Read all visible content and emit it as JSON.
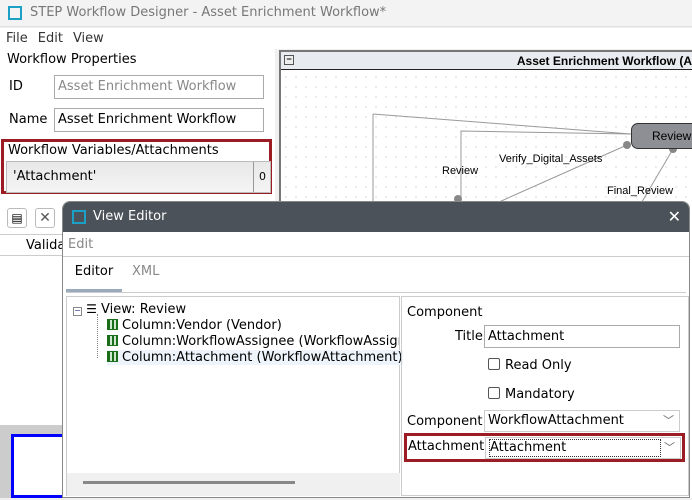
{
  "window": {
    "title": "STEP Workflow Designer - Asset Enrichment Workflow*"
  },
  "menu": [
    "File",
    "Edit",
    "View"
  ],
  "properties": {
    "heading": "Workflow Properties",
    "id_label": "ID",
    "id_value": "Asset Enrichment Workflow",
    "name_label": "Name",
    "name_value": "Asset Enrichment Workflow"
  },
  "variables": {
    "heading": "Workflow Variables/Attachments",
    "item": "'Attachment'",
    "item_icon": "attachment-icon"
  },
  "toolbar": {
    "column_header": "Validat"
  },
  "canvas": {
    "title": "Asset Enrichment Workflow (A",
    "node": "Review",
    "edges": [
      "Review",
      "Verify_Digital_Assets",
      "Final_Review"
    ]
  },
  "dialog": {
    "title": "View Editor",
    "menu": "Edit",
    "tabs": [
      "Editor",
      "XML"
    ],
    "active_tab": "Editor",
    "tree": {
      "root": "View: Review",
      "children": [
        "Column:Vendor (Vendor)",
        "Column:WorkflowAssignee (WorkflowAssignee)",
        "Column:Attachment (WorkflowAttachment)"
      ]
    },
    "component": {
      "heading": "Component",
      "title_label": "Title",
      "title_value": "Attachment",
      "read_only": "Read Only",
      "read_only_checked": false,
      "mandatory": "Mandatory",
      "mandatory_checked": false,
      "component_label": "Component",
      "component_value": "WorkflowAttachment",
      "attachment_label": "Attachment",
      "attachment_value": "Attachment"
    }
  },
  "colors": {
    "accent": "#1ba1c6",
    "highlight": "#9b1c22",
    "dialog_title": "#4b5259"
  }
}
